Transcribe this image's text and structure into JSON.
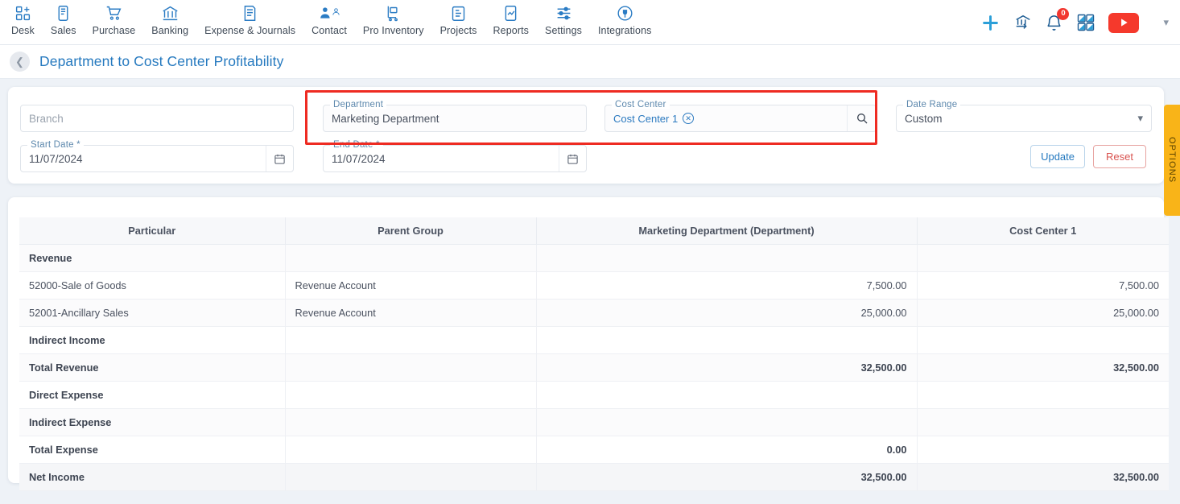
{
  "topnav": {
    "items": [
      {
        "label": "Desk",
        "icon": "desk-grid-plus-icon"
      },
      {
        "label": "Sales",
        "icon": "sales-mobile-icon"
      },
      {
        "label": "Purchase",
        "icon": "purchase-cart-icon"
      },
      {
        "label": "Banking",
        "icon": "banking-bank-icon"
      },
      {
        "label": "Expense & Journals",
        "icon": "expense-journal-icon"
      },
      {
        "label": "Contact",
        "icon": "contact-people-icon"
      },
      {
        "label": "Pro Inventory",
        "icon": "inventory-trolley-icon"
      },
      {
        "label": "Projects",
        "icon": "projects-clipboard-icon"
      },
      {
        "label": "Reports",
        "icon": "reports-chart-icon"
      },
      {
        "label": "Settings",
        "icon": "settings-sliders-icon"
      },
      {
        "label": "Integrations",
        "icon": "integrations-plug-icon"
      }
    ],
    "actions": {
      "add": "add-plus-icon",
      "bank": "bank-transfer-icon",
      "notifications": "notification-bell-icon",
      "notification_count": "0",
      "apps": "apps-grid-icon",
      "video": "youtube-play-icon",
      "user_menu": "chevron-down-icon"
    }
  },
  "header": {
    "back": "chevron-left-icon",
    "title": "Department to Cost Center Profitability"
  },
  "filters": {
    "branch": {
      "label": "",
      "placeholder": "Branch",
      "value": ""
    },
    "start_date": {
      "label": "Start Date *",
      "value": "11/07/2024",
      "icon": "calendar-icon"
    },
    "department": {
      "label": "Department",
      "value": "Marketing Department"
    },
    "end_date": {
      "label": "End Date *",
      "value": "11/07/2024",
      "icon": "calendar-icon"
    },
    "cost_center": {
      "label": "Cost Center",
      "chip": "Cost Center 1",
      "remove_icon": "close-circle-icon",
      "search_icon": "search-icon"
    },
    "date_range": {
      "label": "Date Range",
      "value": "Custom",
      "icon": "chevron-down-icon"
    },
    "update_label": "Update",
    "reset_label": "Reset"
  },
  "options_tab": {
    "label": "OPTIONS"
  },
  "report": {
    "columns": [
      "Particular",
      "Parent Group",
      "Marketing Department (Department)",
      "Cost Center 1"
    ],
    "rows": [
      {
        "particular": "Revenue",
        "parent": "",
        "dept": "",
        "cc": "",
        "bold": true,
        "net": false
      },
      {
        "particular": "52000-Sale of Goods",
        "parent": "Revenue Account",
        "dept": "7,500.00",
        "cc": "7,500.00",
        "bold": false,
        "net": false
      },
      {
        "particular": "52001-Ancillary Sales",
        "parent": "Revenue Account",
        "dept": "25,000.00",
        "cc": "25,000.00",
        "bold": false,
        "net": false
      },
      {
        "particular": "Indirect Income",
        "parent": "",
        "dept": "",
        "cc": "",
        "bold": true,
        "net": false
      },
      {
        "particular": "Total Revenue",
        "parent": "",
        "dept": "32,500.00",
        "cc": "32,500.00",
        "bold": true,
        "net": false
      },
      {
        "particular": "Direct Expense",
        "parent": "",
        "dept": "",
        "cc": "",
        "bold": true,
        "net": false
      },
      {
        "particular": "Indirect Expense",
        "parent": "",
        "dept": "",
        "cc": "",
        "bold": true,
        "net": false
      },
      {
        "particular": "Total Expense",
        "parent": "",
        "dept": "0.00",
        "cc": "",
        "bold": true,
        "net": false
      },
      {
        "particular": "Net Income",
        "parent": "",
        "dept": "32,500.00",
        "cc": "32,500.00",
        "bold": true,
        "net": true
      }
    ]
  },
  "colors": {
    "accent_blue": "#2579bf",
    "icon_blue": "#2b7cc4",
    "highlight_red": "#ee2b22",
    "options_yellow": "#f9b418",
    "reset_red": "#d9534f",
    "page_bg": "#eef2f7"
  }
}
